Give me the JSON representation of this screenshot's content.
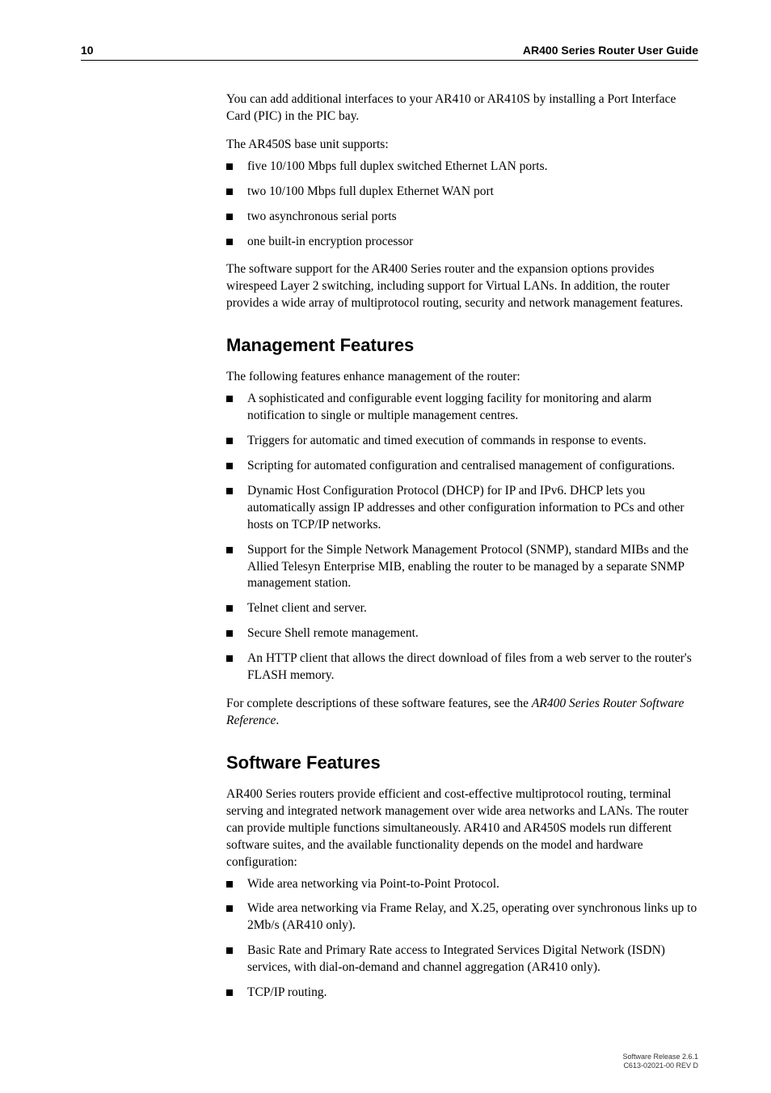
{
  "header": {
    "page_number": "10",
    "title": "AR400 Series Router User Guide"
  },
  "intro": {
    "p1": "You can add additional interfaces to your AR410 or AR410S by installing a Port Interface Card (PIC) in the PIC bay.",
    "p2": "The AR450S base unit supports:",
    "bullets": [
      "five 10/100 Mbps full duplex switched Ethernet LAN ports.",
      "two 10/100 Mbps full duplex Ethernet WAN port",
      "two asynchronous serial ports",
      "one built-in encryption processor"
    ],
    "p3": "The software support for the AR400 Series router and the expansion options provides wirespeed Layer 2 switching, including support for Virtual LANs. In addition, the router provides a wide array of multiprotocol routing, security and network management features."
  },
  "management": {
    "heading": "Management Features",
    "p1": "The following features enhance management of the router:",
    "bullets": [
      "A sophisticated and configurable event logging facility for monitoring and alarm notification to single or multiple management centres.",
      "Triggers for automatic and timed execution of commands in response to events.",
      "Scripting for automated configuration and centralised management of configurations.",
      "Dynamic Host Configuration Protocol (DHCP) for IP and IPv6. DHCP lets you automatically assign IP addresses and other configuration information to PCs and other hosts on TCP/IP networks.",
      "Support for the Simple Network Management Protocol (SNMP), standard MIBs and the Allied Telesyn Enterprise MIB, enabling the router to be managed by a separate SNMP management station.",
      "Telnet client and server.",
      "Secure Shell remote management.",
      "An HTTP client that allows the direct download of files from a web server to the router's FLASH memory."
    ],
    "p2_pre": "For complete descriptions of these software features, see the ",
    "p2_italic": "AR400 Series Router Software Reference",
    "p2_post": "."
  },
  "software": {
    "heading": "Software Features",
    "p1": "AR400 Series routers provide efficient and cost-effective multiprotocol routing, terminal serving and integrated network management over wide area networks and LANs. The router can provide multiple functions simultaneously. AR410 and AR450S models run different software suites, and the available functionality depends on the model and hardware configuration:",
    "bullets": [
      "Wide area networking via Point-to-Point Protocol.",
      "Wide area networking via Frame Relay, and X.25, operating over synchronous links up to 2Mb/s (AR410 only).",
      "Basic Rate and Primary Rate access to Integrated Services Digital Network (ISDN) services, with dial-on-demand and channel aggregation (AR410 only).",
      "TCP/IP routing."
    ]
  },
  "footer": {
    "line1": "Software Release 2.6.1",
    "line2": "C613-02021-00 REV D"
  }
}
